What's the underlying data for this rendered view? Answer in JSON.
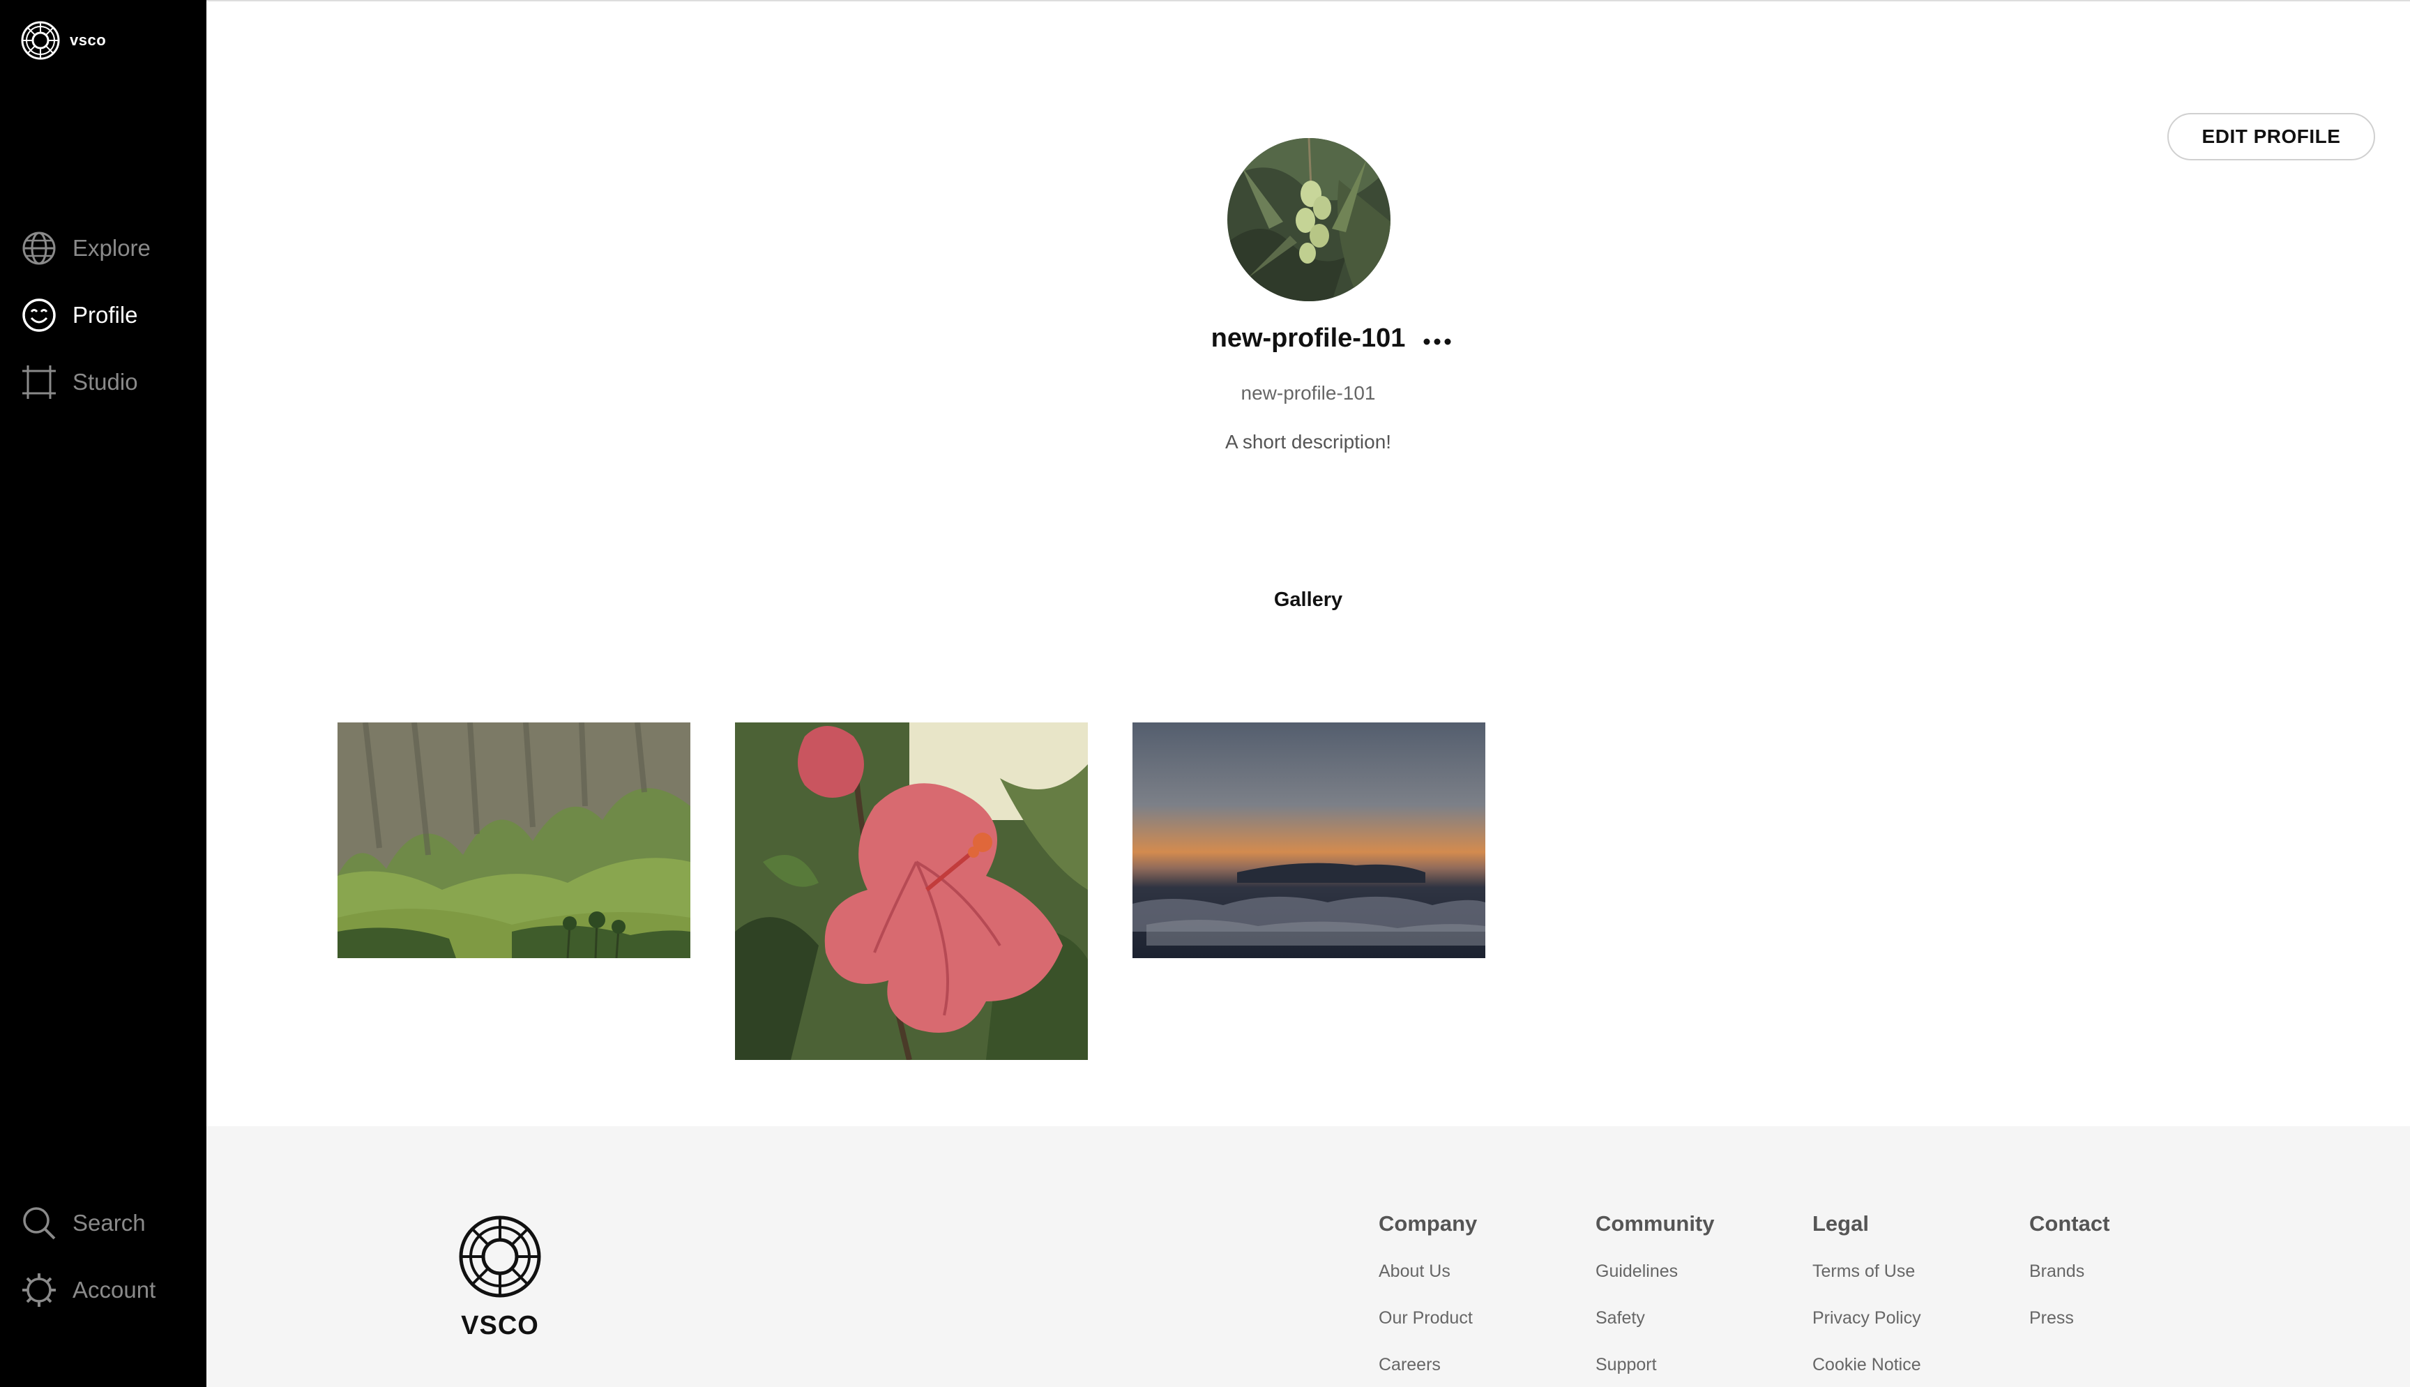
{
  "app": {
    "logo_text": "vsco"
  },
  "sidebar": {
    "nav": [
      {
        "label": "Explore",
        "icon": "globe-icon"
      },
      {
        "label": "Profile",
        "icon": "smile-icon",
        "active": true
      },
      {
        "label": "Studio",
        "icon": "crop-icon"
      }
    ],
    "bottom": [
      {
        "label": "Search",
        "icon": "search-icon"
      },
      {
        "label": "Account",
        "icon": "gear-icon"
      }
    ]
  },
  "profile": {
    "edit_label": "EDIT PROFILE",
    "display_name": "new-profile-101",
    "handle": "new-profile-101",
    "description": "A short description!",
    "more_icon": "ellipsis-icon"
  },
  "gallery": {
    "tab_label": "Gallery",
    "photos": [
      {
        "subject": "green valley with cliffs"
      },
      {
        "subject": "pink hibiscus flower"
      },
      {
        "subject": "sunset above clouds"
      }
    ]
  },
  "footer": {
    "wordmark": "VSCO",
    "columns": [
      {
        "title": "Company",
        "links": [
          "About Us",
          "Our Product",
          "Careers"
        ]
      },
      {
        "title": "Community",
        "links": [
          "Guidelines",
          "Safety",
          "Support"
        ]
      },
      {
        "title": "Legal",
        "links": [
          "Terms of Use",
          "Privacy Policy",
          "Cookie Notice"
        ]
      },
      {
        "title": "Contact",
        "links": [
          "Brands",
          "Press"
        ]
      }
    ]
  },
  "colors": {
    "sidebar_bg": "#000000",
    "footer_bg": "#f5f5f5",
    "inactive_nav": "#8a8a8a"
  }
}
